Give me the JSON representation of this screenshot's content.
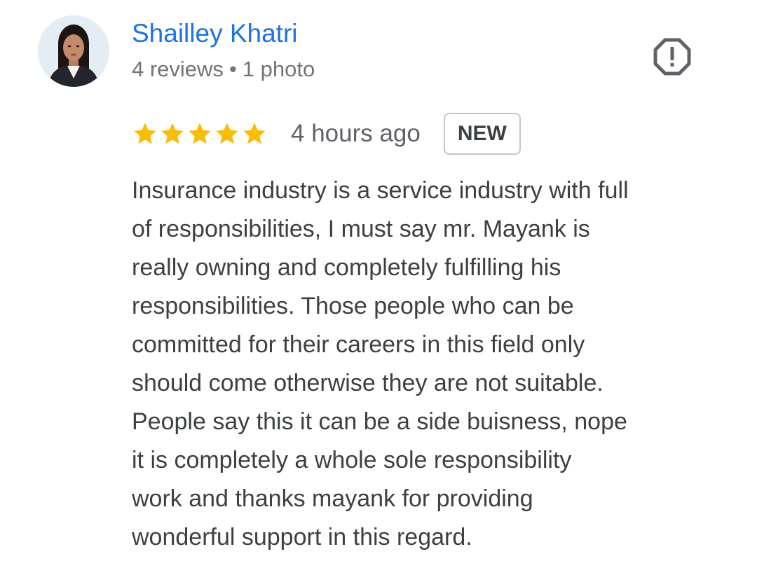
{
  "reviewer": {
    "name": "Shailley Khatri",
    "reviews": "4 reviews",
    "separator": "•",
    "photos": "1 photo"
  },
  "rating": {
    "stars": 5,
    "max": 5,
    "star_color": "#fbbc04"
  },
  "timestamp": "4 hours ago",
  "badge": "NEW",
  "review": {
    "lines": [
      "Insurance industry is a service industry with full",
      "of responsibilities, I must say mr. Mayank is",
      "really owning and completely fulfilling his",
      "responsibilities. Those people who can be",
      "committed for their careers in this field only",
      "should come otherwise they are not suitable.",
      "People say this it can be a side buisness, nope",
      "it is completely a whole sole responsibility",
      "work and thanks mayank for providing",
      "wonderful support in this regard."
    ]
  },
  "icons": {
    "report": "report-octagon-icon",
    "star": "star-icon"
  },
  "colors": {
    "link": "#1a73e8",
    "meta": "#70757a",
    "text": "#3c4043",
    "star": "#fbbc04"
  }
}
